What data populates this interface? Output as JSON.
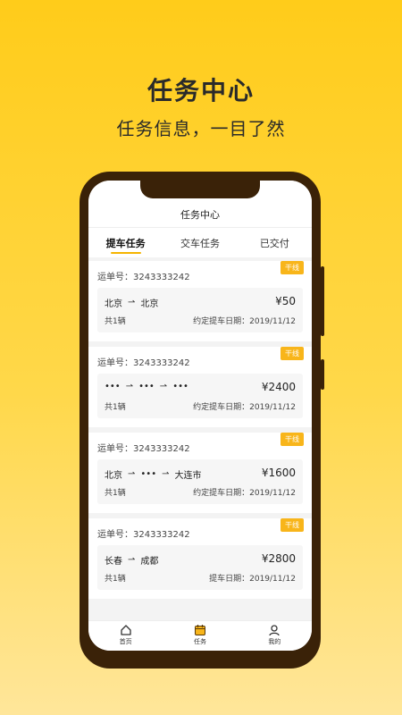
{
  "promo": {
    "title": "任务中心",
    "subtitle": "任务信息，一目了然"
  },
  "app": {
    "header_title": "任务中心",
    "tabs": [
      {
        "label": "提车任务",
        "active": true
      },
      {
        "label": "交车任务",
        "active": false
      },
      {
        "label": "已交付",
        "active": false
      }
    ],
    "orders": [
      {
        "tag": "干线",
        "waybill": "运单号：3243333242",
        "stops": [
          "北京",
          "北京"
        ],
        "arrow": "⇀",
        "price": "¥50",
        "count": "共1辆",
        "date": "约定提车日期：2019/11/12"
      },
      {
        "tag": "干线",
        "waybill": "运单号：3243333242",
        "stops": [
          "•••",
          "•••",
          "•••"
        ],
        "arrow": "⇀",
        "price": "¥2400",
        "count": "共1辆",
        "date": "约定提车日期：2019/11/12"
      },
      {
        "tag": "干线",
        "waybill": "运单号：3243333242",
        "stops": [
          "北京",
          "•••",
          "大连市"
        ],
        "arrow": "⇀",
        "price": "¥1600",
        "count": "共1辆",
        "date": "约定提车日期：2019/11/12"
      },
      {
        "tag": "干线",
        "waybill": "运单号：3243333242",
        "stops": [
          "长春",
          "成都"
        ],
        "arrow": "⇀",
        "price": "¥2800",
        "count": "共1辆",
        "date": "提车日期：2019/11/12"
      }
    ],
    "nav": [
      {
        "label": "首页",
        "icon": "home-icon",
        "active": false
      },
      {
        "label": "任务",
        "icon": "calendar-icon",
        "active": true
      },
      {
        "label": "我的",
        "icon": "user-icon",
        "active": false
      }
    ],
    "colors": {
      "accent": "#f8b51a",
      "bezel": "#3a2208",
      "background_top": "#ffcc1a",
      "background_bottom": "#ffe69a"
    }
  }
}
